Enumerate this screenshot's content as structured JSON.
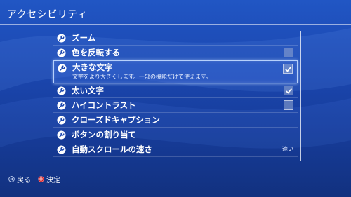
{
  "header": {
    "title": "アクセシビリティ"
  },
  "items": [
    {
      "label": "ズーム",
      "icon": "wrench-icon"
    },
    {
      "label": "色を反転する",
      "icon": "wrench-icon",
      "checked": false
    },
    {
      "label": "大きな文字",
      "description": "文字をより大きくします。一部の機能だけで使えます。",
      "icon": "wrench-icon",
      "checked": true,
      "selected": true
    },
    {
      "label": "太い文字",
      "icon": "wrench-icon",
      "checked": true
    },
    {
      "label": "ハイコントラスト",
      "icon": "wrench-icon",
      "checked": false
    },
    {
      "label": "クローズドキャプション",
      "icon": "wrench-icon"
    },
    {
      "label": "ボタンの割り当て",
      "icon": "wrench-icon"
    },
    {
      "label": "自動スクロールの速さ",
      "icon": "wrench-icon",
      "value": "速い"
    }
  ],
  "footer": {
    "back_label": "戻る",
    "back_icon": "cross-button-icon",
    "confirm_label": "決定",
    "confirm_icon": "circle-button-icon"
  },
  "colors": {
    "background": "#1b47b0",
    "highlight_border": "#bed7ff",
    "circle_button": "#d2232a"
  }
}
